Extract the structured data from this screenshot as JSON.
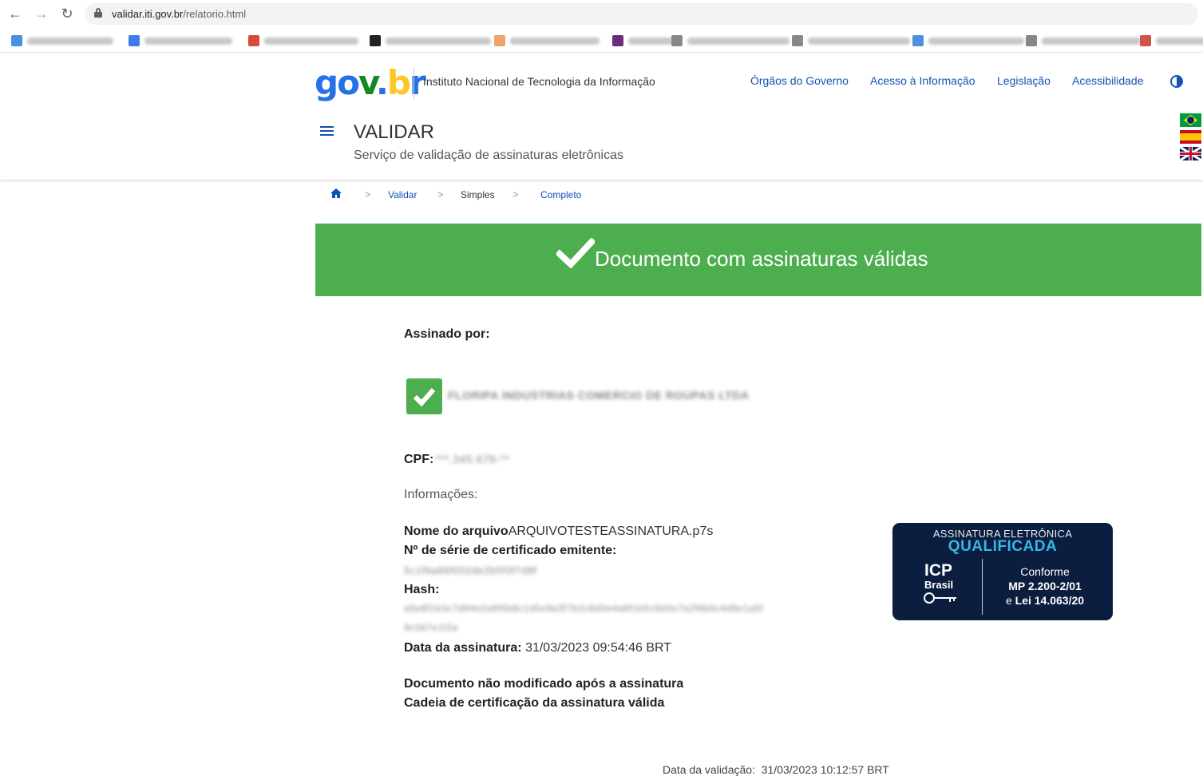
{
  "browser": {
    "url_host": "validar.iti.gov.br",
    "url_path": "/relatorio.html"
  },
  "header": {
    "logo": {
      "g": "g",
      "o": "o",
      "v": "v",
      "dot": ".",
      "b": "b",
      "r": "r"
    },
    "institution": "Instituto Nacional de Tecnologia da Informação",
    "links": [
      "Órgãos do Governo",
      "Acesso à Informação",
      "Legislação",
      "Acessibilidade"
    ],
    "app_title": "VALIDAR",
    "app_subtitle": "Serviço de validação de assinaturas eletrônicas"
  },
  "breadcrumb": [
    "Validar",
    "Simples",
    "Completo"
  ],
  "banner": {
    "text": "Documento com assinaturas válidas",
    "color": "#4cae4f"
  },
  "report": {
    "signed_by_label": "Assinado por:",
    "signer_name": "FLORIPA INDUSTRIAS COMERCIO DE ROUPAS LTDA",
    "cpf_label": "CPF:",
    "cpf_value": "***.345.678-**",
    "info_label": "Informações:",
    "file_label": "Nome do arquivo",
    "file_value": "ARQUIVOTESTEASSINATURA.p7s",
    "serial_label": "Nº de série de certificado emitente:",
    "serial_value": "5c1f6a86f002de2b5f3f7d8f",
    "hash_label": "Hash:",
    "hash_line1": "a5e8f1b3c7d94e2a6f0b8c1d5e9a3f7b2c6d0e4a8f1b5c9d3e7a2f6b0c4d8e1a5f",
    "hash_line2": "9c3d7e1f2a",
    "date_label": "Data da assinatura:",
    "date_value": "31/03/2023 09:54:46 BRT",
    "status1": "Documento não modificado após a assinatura",
    "status2": "Cadeia de certificação da assinatura válida",
    "validation_label": "Data da validação:",
    "validation_value": "31/03/2023 10:12:57 BRT"
  },
  "seal": {
    "line1": "ASSINATURA ELETRÔNICA",
    "line2": "QUALIFICADA",
    "icp": "ICP",
    "brasil": "Brasil",
    "conf1": "Conforme",
    "conf2": "MP 2.200-2/01",
    "conf3_prefix": "e",
    "conf3": "Lei 14.063/20",
    "background": "#0b1e3f",
    "accent": "#37b6e9"
  }
}
